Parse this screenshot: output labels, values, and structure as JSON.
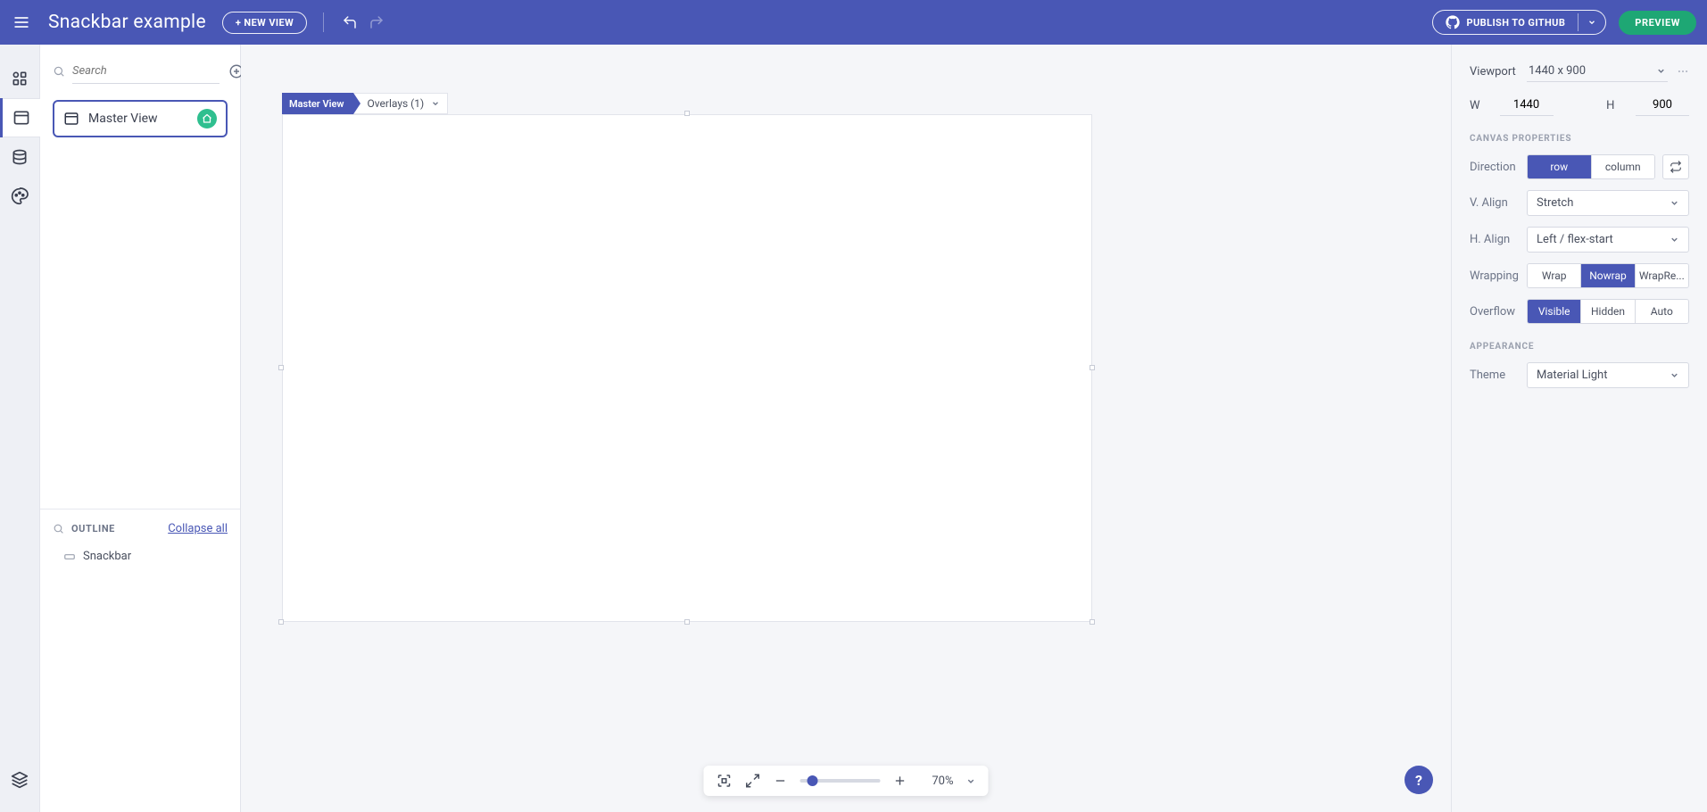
{
  "header": {
    "title": "Snackbar example",
    "new_view": "+ NEW VIEW",
    "publish": "PUBLISH TO GITHUB",
    "preview": "PREVIEW"
  },
  "left": {
    "search_placeholder": "Search",
    "view_label": "Master View",
    "outline_label": "OUTLINE",
    "collapse_all": "Collapse all",
    "outline_item": "Snackbar"
  },
  "breadcrumb": {
    "master": "Master View",
    "overlays": "Overlays (1)"
  },
  "zoom": {
    "percent": "70%"
  },
  "right": {
    "viewport_label": "Viewport",
    "viewport_value": "1440 x 900",
    "w_label": "W",
    "w_value": "1440",
    "h_label": "H",
    "h_value": "900",
    "canvas_properties": "CANVAS PROPERTIES",
    "direction_label": "Direction",
    "direction_row": "row",
    "direction_column": "column",
    "valign_label": "V. Align",
    "valign_value": "Stretch",
    "halign_label": "H. Align",
    "halign_value": "Left / flex-start",
    "wrapping_label": "Wrapping",
    "wrap_wrap": "Wrap",
    "wrap_nowrap": "Nowrap",
    "wrap_rev": "WrapRe...",
    "overflow_label": "Overflow",
    "overflow_visible": "Visible",
    "overflow_hidden": "Hidden",
    "overflow_auto": "Auto",
    "appearance": "APPEARANCE",
    "theme_label": "Theme",
    "theme_value": "Material Light"
  },
  "help": "?"
}
